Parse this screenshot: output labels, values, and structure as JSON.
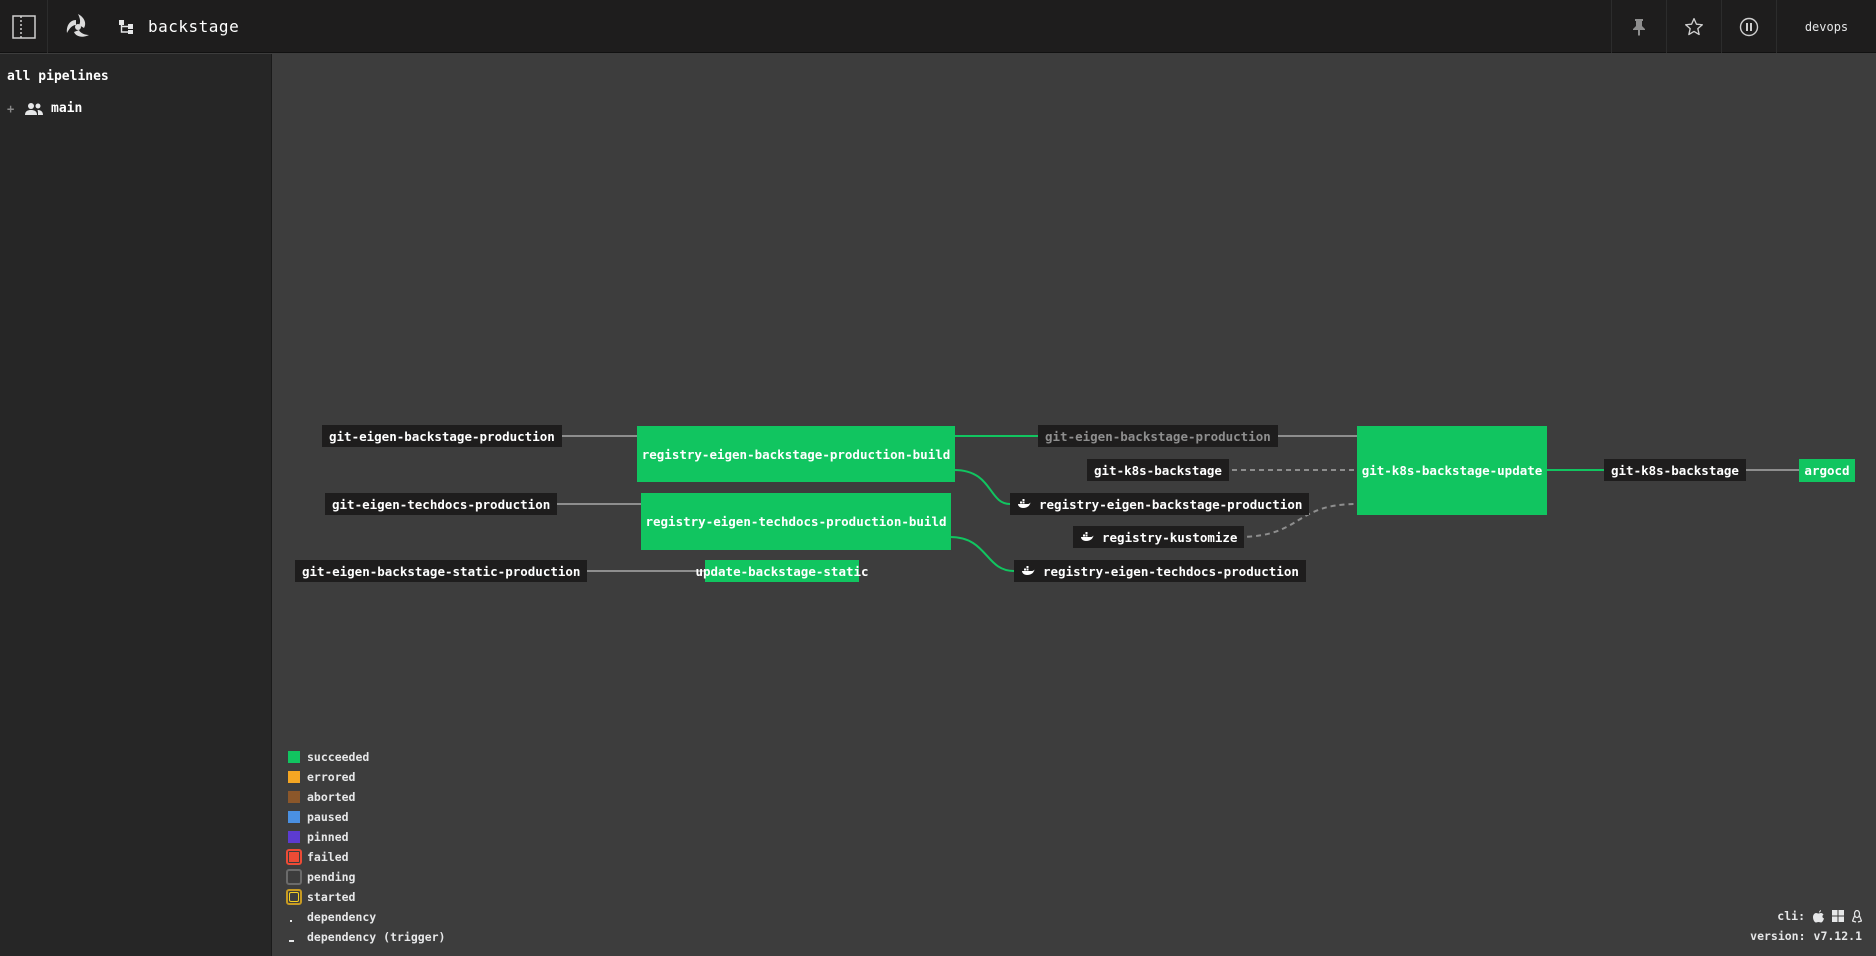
{
  "topbar": {
    "pipeline_name": "backstage",
    "user": "devops"
  },
  "sidebar": {
    "header": "all pipelines",
    "teams": [
      {
        "name": "main"
      }
    ]
  },
  "graph": {
    "resources": {
      "git_eigen_backstage_production": "git-eigen-backstage-production",
      "git_eigen_techdocs_production": "git-eigen-techdocs-production",
      "git_eigen_backstage_static_production": "git-eigen-backstage-static-production",
      "git_eigen_backstage_production_2": "git-eigen-backstage-production",
      "git_k8s_backstage_in": "git-k8s-backstage",
      "registry_eigen_backstage_production": "registry-eigen-backstage-production",
      "registry_kustomize": "registry-kustomize",
      "registry_eigen_techdocs_production": "registry-eigen-techdocs-production",
      "git_k8s_backstage_out": "git-k8s-backstage"
    },
    "jobs": {
      "registry_eigen_backstage_production_build": "registry-eigen-backstage-production-build",
      "registry_eigen_techdocs_production_build": "registry-eigen-techdocs-production-build",
      "update_backstage_static": "update-backstage-static",
      "git_k8s_backstage_update": "git-k8s-backstage-update",
      "argocd": "argocd"
    },
    "job_status": "succeeded",
    "colors": {
      "succeeded": "#11c560",
      "resource_bg": "#1e1d1d",
      "edge": "#8e8e8e"
    }
  },
  "legend": [
    {
      "label": "succeeded",
      "color": "#11c560",
      "kind": "square"
    },
    {
      "label": "errored",
      "color": "#f5a623",
      "kind": "square"
    },
    {
      "label": "aborted",
      "color": "#8b572a",
      "kind": "square"
    },
    {
      "label": "paused",
      "color": "#4a90e2",
      "kind": "square"
    },
    {
      "label": "pinned",
      "color": "#5c3bd1",
      "kind": "square"
    },
    {
      "label": "failed",
      "color": "#ed4b35",
      "kind": "ring"
    },
    {
      "label": "pending",
      "color": "#9b9b9b",
      "kind": "ring"
    },
    {
      "label": "started",
      "color": "#f5a623",
      "kind": "ring"
    },
    {
      "label": "dependency",
      "kind": "dot"
    },
    {
      "label": "dependency (trigger)",
      "kind": "dash"
    }
  ],
  "footer": {
    "cli_label": "cli:",
    "version_label": "version:",
    "version": "v7.12.1"
  },
  "icons": [
    "sidebar-toggle-icon",
    "concourse-logo-icon",
    "pipeline-icon",
    "team-icon",
    "pin-icon",
    "star-icon",
    "pause-icon",
    "docker-icon",
    "apple-icon",
    "windows-icon",
    "linux-icon"
  ]
}
